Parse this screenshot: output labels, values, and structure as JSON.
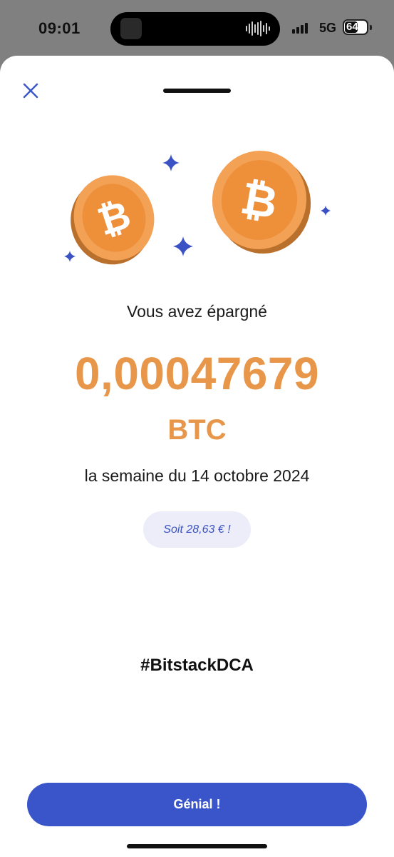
{
  "status_bar": {
    "time": "09:01",
    "network": "5G",
    "battery": "64",
    "battery_level_percent": 64
  },
  "sheet": {
    "close_icon": "close-icon",
    "subtitle": "Vous avez épargné",
    "amount": "0,00047679",
    "unit": "BTC",
    "period": "la semaine du 14 octobre 2024",
    "fiat_badge": "Soit 28,63 € !",
    "hashtag": "#BitstackDCA",
    "cta_label": "Génial !"
  },
  "colors": {
    "accent_orange": "#E8974A",
    "primary_blue": "#3A55C9",
    "badge_bg": "#ECEDF8",
    "sparkle_blue": "#3A52C4"
  },
  "icons": [
    "close-icon",
    "bitcoin-coin-icon",
    "sparkle-icon"
  ]
}
